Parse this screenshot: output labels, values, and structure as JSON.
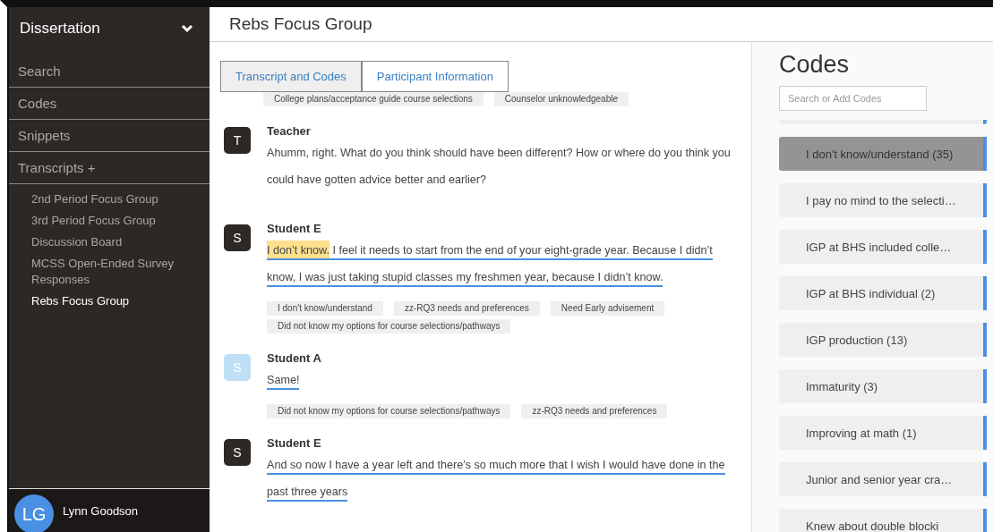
{
  "sidebar": {
    "project": "Dissertation",
    "nav": [
      {
        "label": "Search"
      },
      {
        "label": "Codes"
      },
      {
        "label": "Snippets"
      },
      {
        "label": "Transcripts +"
      }
    ],
    "transcripts": [
      {
        "label": "2nd Period Focus Group",
        "selected": false
      },
      {
        "label": "3rd Period Focus Group",
        "selected": false
      },
      {
        "label": "Discussion Board",
        "selected": false
      },
      {
        "label": "MCSS Open-Ended Survey Responses",
        "selected": false
      },
      {
        "label": "Rebs Focus Group",
        "selected": true
      }
    ],
    "user": {
      "initials": "LG",
      "name": "Lynn Goodson"
    }
  },
  "header": {
    "title": "Rebs Focus Group"
  },
  "tabs": [
    {
      "label": "Transcript and Codes",
      "selected": true
    },
    {
      "label": "Participant Information",
      "selected": false
    }
  ],
  "transcript": {
    "top_tags": [
      "College plans/acceptance guide course selections",
      "Counselor unknowledgeable"
    ],
    "turns": [
      {
        "avatar": "T",
        "kind": "dark",
        "speaker": "Teacher",
        "segments": [
          {
            "text": "Ahumm, right. What do you think should have been different? How or where do you think you could have gotten advice better and earlier?",
            "coded": false,
            "highlighted": false
          }
        ]
      },
      {
        "avatar": "S",
        "kind": "dark",
        "speaker": "Student E",
        "segments": [
          {
            "text": "I don’t know.",
            "coded": true,
            "highlighted": true
          },
          {
            "text": " I feel it needs to start from the end of your eight-grade year. Because I didn’t know, I was just taking stupid classes my freshmen year, because I didn’t know.",
            "coded": true,
            "highlighted": false
          }
        ],
        "tags": [
          "I don't know/understand",
          "zz-RQ3 needs and preferences",
          "Need Early advisement",
          "Did not know my options for course selections/pathways"
        ]
      },
      {
        "avatar": "S",
        "kind": "light",
        "speaker": "Student A",
        "segments": [
          {
            "text": "Same!",
            "coded": true,
            "highlighted": false
          }
        ],
        "tags": [
          "Did not know my options for course selections/pathways",
          "zz-RQ3 needs and preferences"
        ]
      },
      {
        "avatar": "S",
        "kind": "dark",
        "speaker": "Student E",
        "segments": [
          {
            "text": "And so now I have a year left and there’s so much more that I wish I would have done in the past three years",
            "coded": true,
            "highlighted": false
          }
        ]
      }
    ]
  },
  "codes_panel": {
    "title": "Codes",
    "search": {
      "placeholder": "Search or Add Codes"
    },
    "codes": [
      {
        "label": "I don't know/understand (35)",
        "selected": true
      },
      {
        "label": "I pay no mind to the selecti…",
        "selected": false
      },
      {
        "label": "IGP at BHS included colle…",
        "selected": false
      },
      {
        "label": "IGP at BHS individual (2)",
        "selected": false
      },
      {
        "label": "IGP production (13)",
        "selected": false
      },
      {
        "label": "Immaturity (3)",
        "selected": false
      },
      {
        "label": "Improving at math (1)",
        "selected": false
      },
      {
        "label": "Junior and senior year cra…",
        "selected": false
      },
      {
        "label": "Knew about double blocki",
        "selected": false
      }
    ]
  }
}
